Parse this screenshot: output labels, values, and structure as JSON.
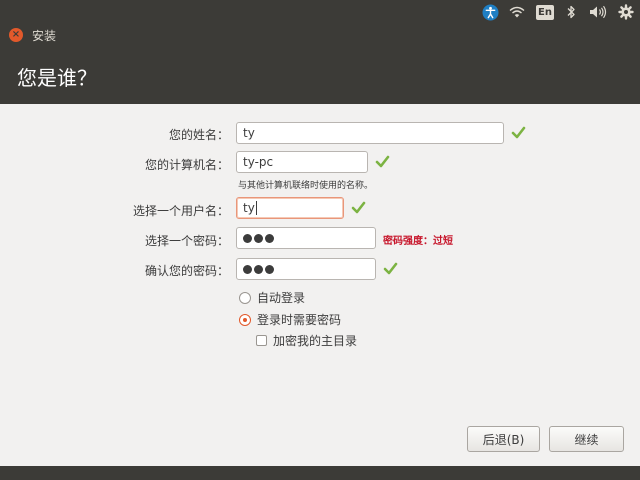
{
  "panel": {
    "lang_indicator": "En",
    "icons": [
      "accessibility-icon",
      "wifi-icon",
      "keyboard-language-icon",
      "bluetooth-icon",
      "volume-icon",
      "gear-icon"
    ]
  },
  "window": {
    "title": "安装",
    "close_glyph": "×"
  },
  "header": {
    "title": "您是谁？"
  },
  "form": {
    "name_label": "您的姓名：",
    "name_value": "ty",
    "computer_label": "您的计算机名：",
    "computer_value": "ty-pc",
    "computer_hint": "与其他计算机联络时使用的名称。",
    "username_label": "选择一个用户名：",
    "username_value": "ty",
    "password_label": "选择一个密码：",
    "password_length": 3,
    "password_strength": "密码强度：过短",
    "confirm_label": "确认您的密码：",
    "confirm_length": 3
  },
  "options": {
    "auto_login": "自动登录",
    "require_password": "登录时需要密码",
    "encrypt_home": "加密我的主目录",
    "selected": "require_password",
    "encrypt_checked": false
  },
  "buttons": {
    "back": "后退(B)",
    "continue": "继续"
  },
  "colors": {
    "accent": "#e2592b",
    "valid_check": "#7cb342",
    "warning": "#c7162b",
    "panel_bg": "#3c3b37"
  }
}
